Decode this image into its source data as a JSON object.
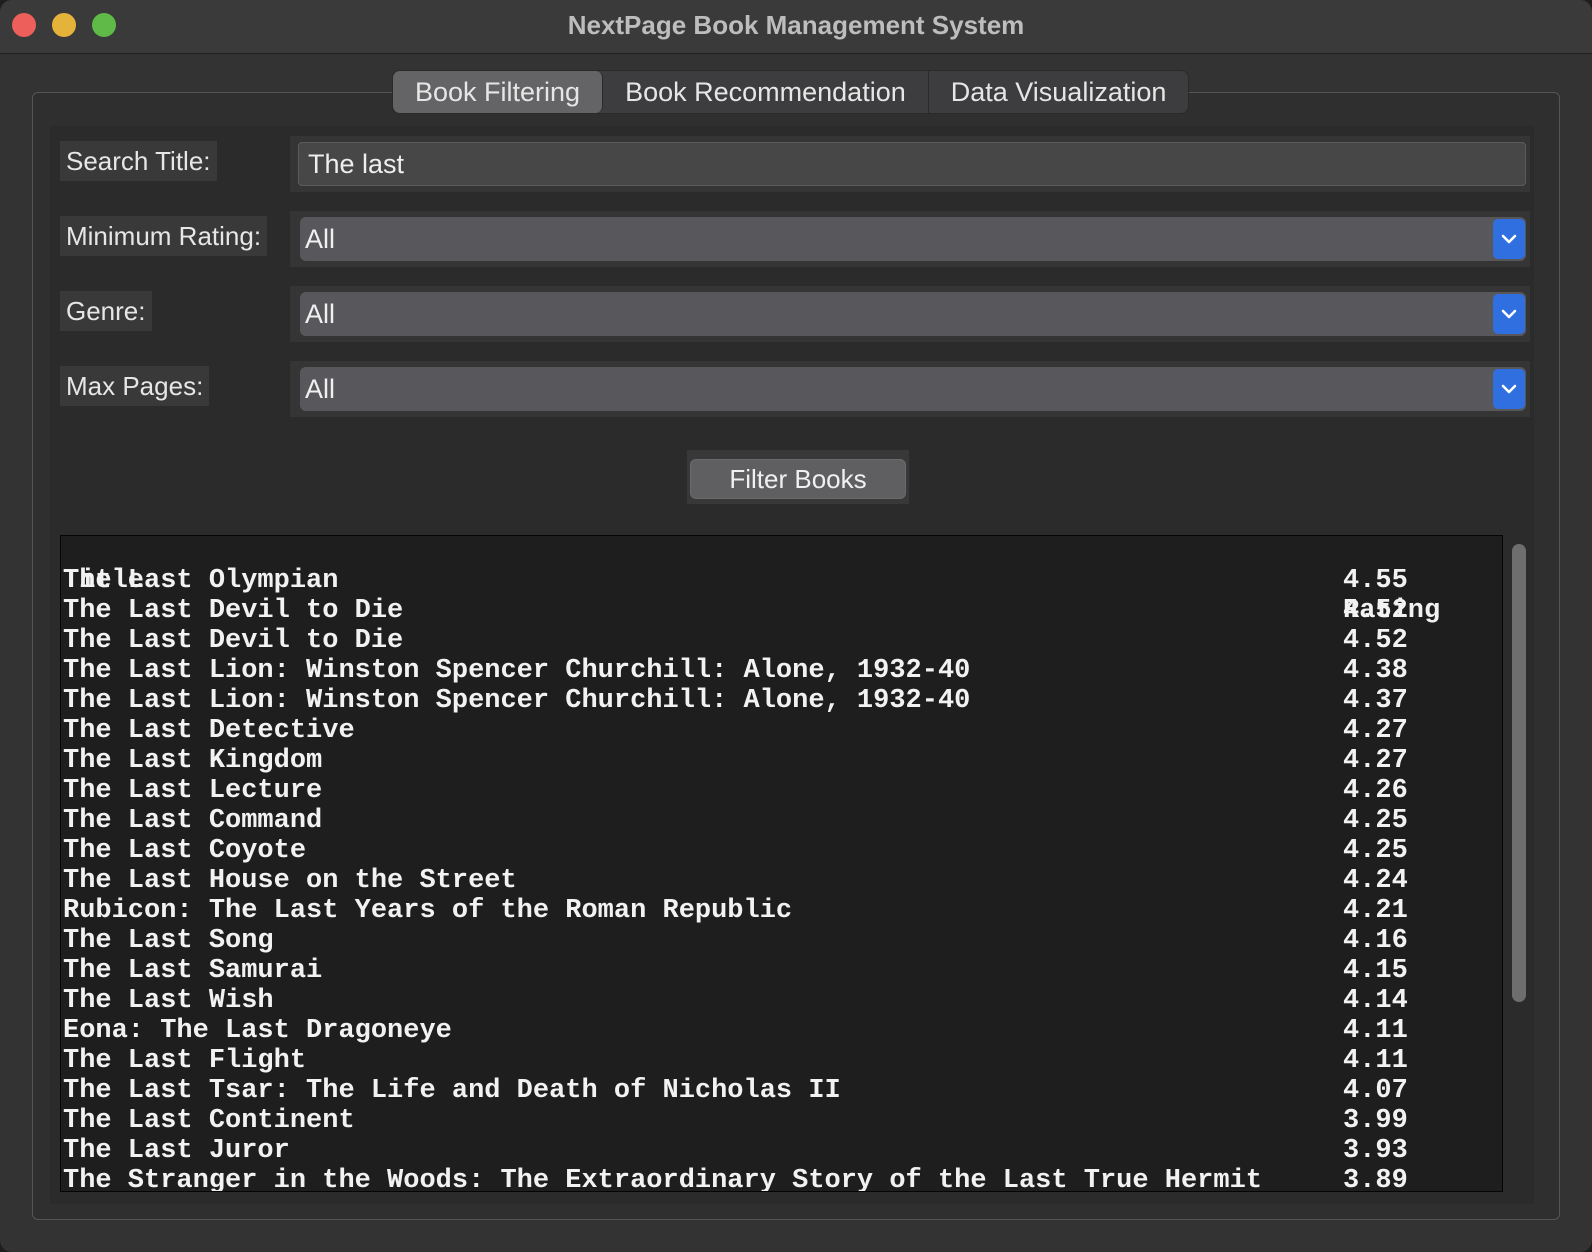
{
  "window": {
    "title": "NextPage Book Management System"
  },
  "tabs": [
    {
      "label": "Book Filtering",
      "active": true
    },
    {
      "label": "Book Recommendation",
      "active": false
    },
    {
      "label": "Data Visualization",
      "active": false
    }
  ],
  "filters": {
    "search_label": "Search Title:",
    "search_value": "The last",
    "rating_label": "Minimum Rating:",
    "rating_value": "All",
    "genre_label": "Genre:",
    "genre_value": "All",
    "pages_label": "Max Pages:",
    "pages_value": "All"
  },
  "filter_button": "Filter Books",
  "results": {
    "columns": [
      "Title",
      "Rating"
    ],
    "rows": [
      [
        "The Last Olympian",
        "4.55"
      ],
      [
        "The Last Devil to Die",
        "4.52"
      ],
      [
        "The Last Devil to Die",
        "4.52"
      ],
      [
        "The Last Lion: Winston Spencer Churchill: Alone, 1932-40",
        "4.38"
      ],
      [
        "The Last Lion: Winston Spencer Churchill: Alone, 1932-40",
        "4.37"
      ],
      [
        "The Last Detective",
        "4.27"
      ],
      [
        "The Last Kingdom",
        "4.27"
      ],
      [
        "The Last Lecture",
        "4.26"
      ],
      [
        "The Last Command",
        "4.25"
      ],
      [
        "The Last Coyote",
        "4.25"
      ],
      [
        "The Last House on the Street",
        "4.24"
      ],
      [
        "Rubicon: The Last Years of the Roman Republic",
        "4.21"
      ],
      [
        "The Last Song",
        "4.16"
      ],
      [
        "The Last Samurai",
        "4.15"
      ],
      [
        "The Last Wish",
        "4.14"
      ],
      [
        "Eona: The Last Dragoneye",
        "4.11"
      ],
      [
        "The Last Flight",
        "4.11"
      ],
      [
        "The Last Tsar: The Life and Death of Nicholas II",
        "4.07"
      ],
      [
        "The Last Continent",
        "3.99"
      ],
      [
        "The Last Juror",
        "3.93"
      ],
      [
        "The Stranger in the Woods: The Extraordinary Story of the Last True Hermit",
        "3.89"
      ]
    ]
  }
}
